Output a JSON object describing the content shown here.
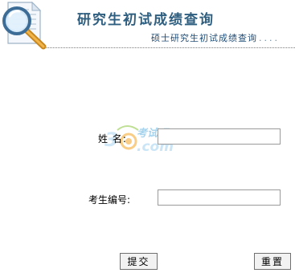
{
  "header": {
    "title": "研究生初试成绩查询",
    "subtitle": "硕士研究生初试成绩查询",
    "subtitle_dots": "....",
    "logo_icon": "magnifier-document-icon"
  },
  "form": {
    "name_label": "姓 名:",
    "name_value": "",
    "exam_no_label": "考生编号:",
    "exam_no_value": ""
  },
  "buttons": {
    "submit_label": "提交",
    "reset_label": "重置"
  },
  "watermark": {
    "text": "考试吧",
    "domain": ".com"
  },
  "colors": {
    "title": "#2f5f80",
    "subtitle": "#1f4e79",
    "watermark": "#5fb0e0"
  }
}
